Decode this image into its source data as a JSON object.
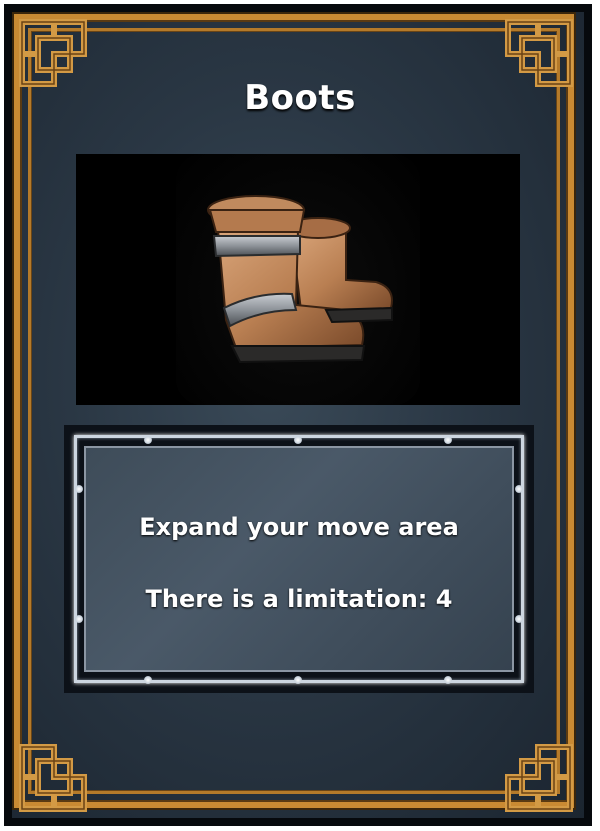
{
  "card": {
    "title": "Boots",
    "item_icon": "boots-icon",
    "description": {
      "line1": "Expand your move area",
      "line2": "There is a limitation: 4"
    }
  },
  "colors": {
    "frame_gold": "#c98a33",
    "card_background": "#2a3744",
    "description_frame": "#cdd6e0",
    "text": "#ffffff"
  }
}
